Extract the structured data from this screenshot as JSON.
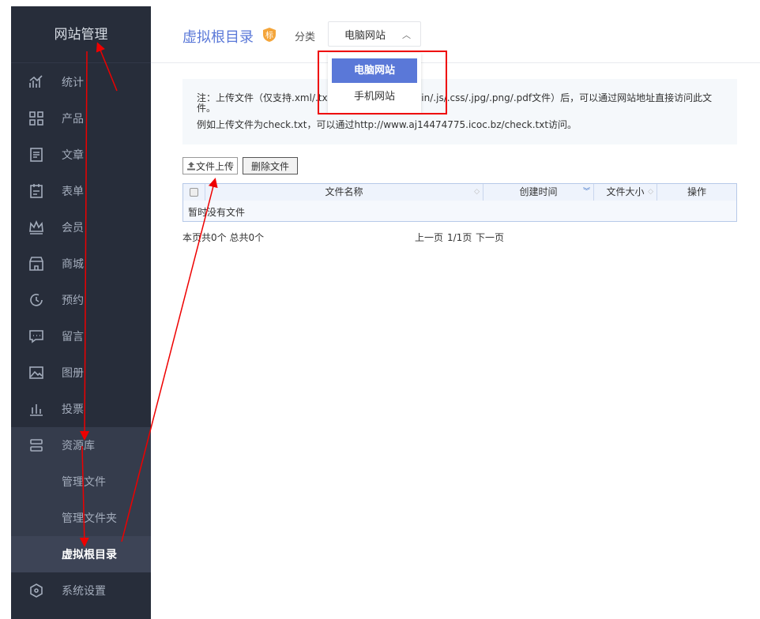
{
  "sidebar": {
    "title": "网站管理",
    "items": [
      {
        "label": "统计",
        "icon": "chart-icon"
      },
      {
        "label": "产品",
        "icon": "grid-icon"
      },
      {
        "label": "文章",
        "icon": "list-icon"
      },
      {
        "label": "表单",
        "icon": "clipboard-icon"
      },
      {
        "label": "会员",
        "icon": "crown-icon"
      },
      {
        "label": "商城",
        "icon": "store-icon"
      },
      {
        "label": "预约",
        "icon": "clock-icon"
      },
      {
        "label": "留言",
        "icon": "message-icon"
      },
      {
        "label": "图册",
        "icon": "image-icon"
      },
      {
        "label": "投票",
        "icon": "bars-icon"
      },
      {
        "label": "资源库",
        "icon": "database-icon"
      }
    ],
    "sub_items": [
      "管理文件",
      "管理文件夹",
      "虚拟根目录"
    ],
    "settings": "系统设置"
  },
  "header": {
    "title": "虚拟根目录",
    "badge": "标",
    "category_label": "分类",
    "category_value": "电脑网站",
    "options": [
      "电脑网站",
      "手机网站"
    ]
  },
  "note": {
    "line1": "注：上传文件（仅支持.xml/.txt/.html/.htm/.cert/.bin/.js/.css/.jpg/.png/.pdf文件）后，可以通过网站地址直接访问此文件。",
    "line2": "例如上传文件为check.txt，可以通过http://www.aj14474775.icoc.bz/check.txt访问。"
  },
  "toolbar": {
    "upload": "文件上传",
    "delete": "删除文件"
  },
  "table": {
    "columns": [
      "文件名称",
      "创建时间",
      "文件大小",
      "操作"
    ],
    "empty": "暂时没有文件"
  },
  "pagination": {
    "summary": "本页共0个 总共0个",
    "prev": "上一页",
    "page": "1/1页",
    "next": "下一页"
  },
  "colors": {
    "accent": "#5a78d8",
    "sidebar": "#272d3a",
    "annotation": "#ee0000"
  }
}
